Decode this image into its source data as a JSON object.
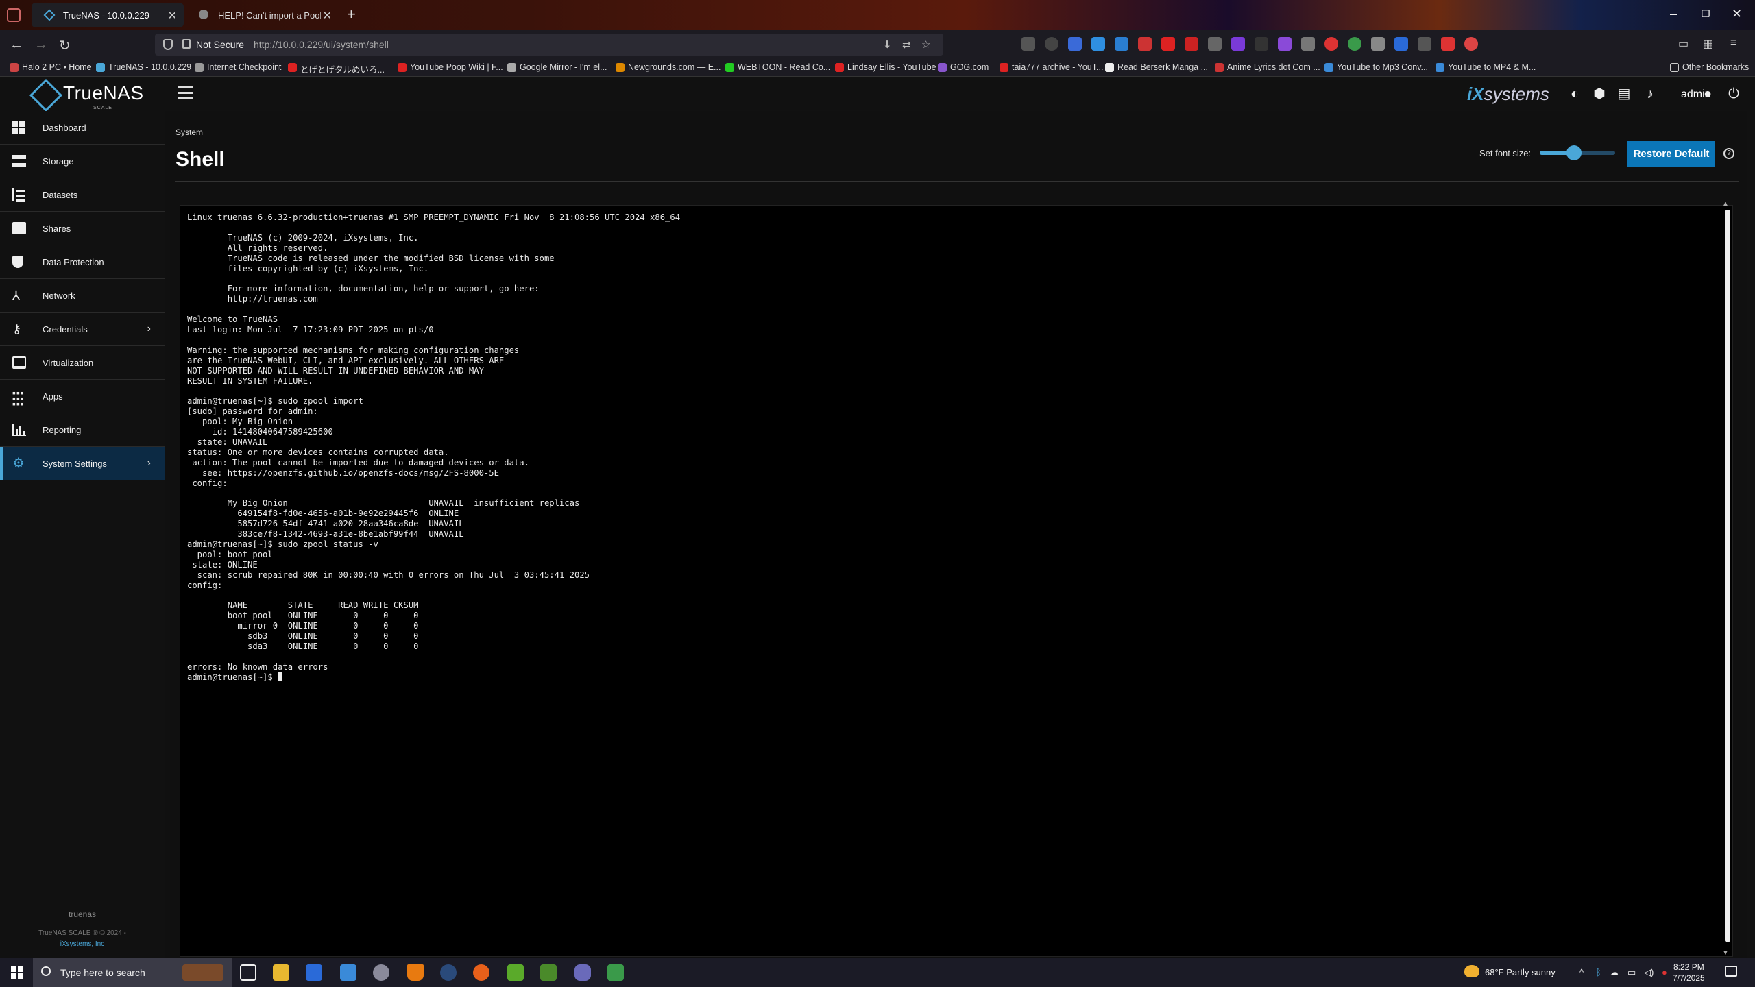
{
  "browser": {
    "tabs": [
      {
        "title": "TrueNAS - 10.0.0.229",
        "active": true
      },
      {
        "title": "HELP! Can't import a Pool, wha",
        "active": false
      }
    ],
    "url_security": "Not Secure",
    "url": "http://10.0.0.229/ui/system/shell",
    "bookmarks": [
      "Halo 2 PC • Home",
      "TrueNAS - 10.0.0.229",
      "Internet Checkpoint",
      "とげとげタルめいろ...",
      "YouTube Poop Wiki | F...",
      "Google Mirror - I'm el...",
      "Newgrounds.com — E...",
      "WEBTOON - Read Co...",
      "Lindsay Ellis - YouTube",
      "GOG.com",
      "taia777 archive - YouT...",
      "Read Berserk Manga ...",
      "Anime Lyrics dot Com ...",
      "YouTube to Mp3 Conv...",
      "YouTube to MP4 & M...",
      "Other Bookmarks"
    ]
  },
  "app": {
    "logo_text": "TrueNAS",
    "logo_sub": "SCALE",
    "vendor_prefix": "iX",
    "vendor_suffix": "systems",
    "user": "admin"
  },
  "sidebar": {
    "items": [
      {
        "label": "Dashboard",
        "has_children": false
      },
      {
        "label": "Storage",
        "has_children": false
      },
      {
        "label": "Datasets",
        "has_children": false
      },
      {
        "label": "Shares",
        "has_children": false
      },
      {
        "label": "Data Protection",
        "has_children": false
      },
      {
        "label": "Network",
        "has_children": false
      },
      {
        "label": "Credentials",
        "has_children": true
      },
      {
        "label": "Virtualization",
        "has_children": false
      },
      {
        "label": "Apps",
        "has_children": false
      },
      {
        "label": "Reporting",
        "has_children": false
      },
      {
        "label": "System Settings",
        "has_children": true,
        "active": true
      }
    ],
    "footer_host": "truenas",
    "footer_copyright": "TrueNAS SCALE ® © 2024 -",
    "footer_company": "iXsystems, Inc"
  },
  "page": {
    "breadcrumb": "System",
    "title": "Shell",
    "font_size_label": "Set font size:",
    "font_size_slider_fraction": 0.45,
    "restore_default_label": "Restore Default"
  },
  "terminal": {
    "lines": [
      "Linux truenas 6.6.32-production+truenas #1 SMP PREEMPT_DYNAMIC Fri Nov  8 21:08:56 UTC 2024 x86_64",
      "",
      "        TrueNAS (c) 2009-2024, iXsystems, Inc.",
      "        All rights reserved.",
      "        TrueNAS code is released under the modified BSD license with some",
      "        files copyrighted by (c) iXsystems, Inc.",
      "",
      "        For more information, documentation, help or support, go here:",
      "        http://truenas.com",
      "",
      "Welcome to TrueNAS",
      "Last login: Mon Jul  7 17:23:09 PDT 2025 on pts/0",
      "",
      "Warning: the supported mechanisms for making configuration changes",
      "are the TrueNAS WebUI, CLI, and API exclusively. ALL OTHERS ARE",
      "NOT SUPPORTED AND WILL RESULT IN UNDEFINED BEHAVIOR AND MAY",
      "RESULT IN SYSTEM FAILURE.",
      "",
      "admin@truenas[~]$ sudo zpool import",
      "[sudo] password for admin:",
      "   pool: My Big Onion",
      "     id: 14148040647589425600",
      "  state: UNAVAIL",
      "status: One or more devices contains corrupted data.",
      " action: The pool cannot be imported due to damaged devices or data.",
      "   see: https://openzfs.github.io/openzfs-docs/msg/ZFS-8000-5E",
      " config:",
      "",
      "        My Big Onion                            UNAVAIL  insufficient replicas",
      "          649154f8-fd0e-4656-a01b-9e92e29445f6  ONLINE",
      "          5857d726-54df-4741-a020-28aa346ca8de  UNAVAIL",
      "          383ce7f8-1342-4693-a31e-8be1abf99f44  UNAVAIL",
      "admin@truenas[~]$ sudo zpool status -v",
      "  pool: boot-pool",
      " state: ONLINE",
      "  scan: scrub repaired 80K in 00:00:40 with 0 errors on Thu Jul  3 03:45:41 2025",
      "config:",
      "",
      "        NAME        STATE     READ WRITE CKSUM",
      "        boot-pool   ONLINE       0     0     0",
      "          mirror-0  ONLINE       0     0     0",
      "            sdb3    ONLINE       0     0     0",
      "            sda3    ONLINE       0     0     0",
      "",
      "errors: No known data errors",
      "admin@truenas[~]$ "
    ]
  },
  "taskbar": {
    "search_placeholder": "Type here to search",
    "weather": "68°F  Partly sunny",
    "time": "8:22 PM",
    "date": "7/7/2025"
  },
  "colors": {
    "accent": "#4aa7d8",
    "button": "#0b76b8",
    "sidebar_active": "#0c2a44"
  }
}
